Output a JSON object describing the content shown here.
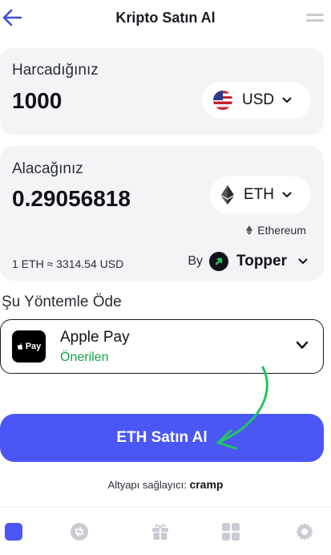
{
  "header": {
    "title": "Kripto Satın Al"
  },
  "spend": {
    "label": "Harcadığınız",
    "amount": "1000",
    "currency": "USD",
    "currency_icon": "us-flag-icon"
  },
  "receive": {
    "label": "Alacağınız",
    "amount": "0.29056818",
    "currency": "ETH",
    "currency_icon": "ethereum-icon",
    "network": "Ethereum",
    "rate": "1 ETH ≈ 3314.54 USD",
    "provider_prefix": "By",
    "provider": "Topper"
  },
  "payment": {
    "heading": "Şu Yöntemle Öde",
    "method_name": "Apple Pay",
    "method_badge": "Önerilen",
    "method_logo_text": "Pay"
  },
  "buy_button": {
    "label": "ETH Satın Al"
  },
  "footer": {
    "powered_prefix": "Altyapı sağlayıcı:",
    "powered_brand": "cramp"
  },
  "tabbar": {
    "items": [
      "home-icon",
      "swap-icon",
      "gift-icon",
      "apps-icon",
      "settings-icon"
    ],
    "active": "home-icon"
  },
  "colors": {
    "accent": "#4b57f5",
    "recommended": "#16a34a",
    "annotation_arrow": "#22c55e"
  }
}
